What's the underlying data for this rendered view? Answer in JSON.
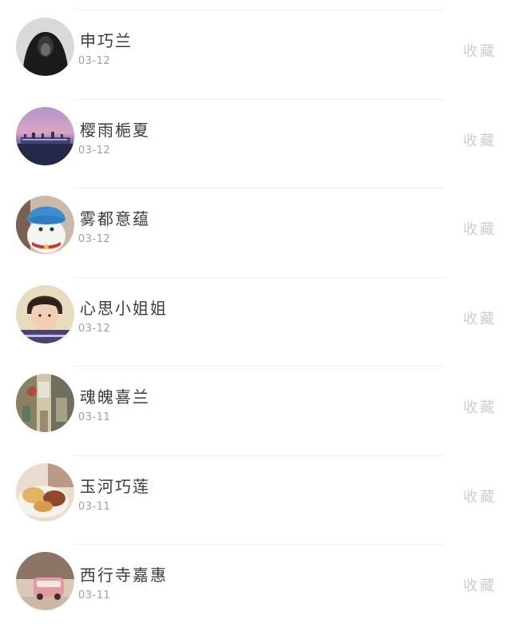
{
  "favorite_label": "收藏",
  "contacts": [
    {
      "name": "申巧兰",
      "date": "03-12",
      "avatar_icon": "hooded-person-avatar"
    },
    {
      "name": "樱雨梔夏",
      "date": "03-12",
      "avatar_icon": "city-skyline-avatar"
    },
    {
      "name": "雾都意蕴",
      "date": "03-12",
      "avatar_icon": "cat-in-hat-avatar"
    },
    {
      "name": "心思小姐姐",
      "date": "03-12",
      "avatar_icon": "boy-portrait-avatar"
    },
    {
      "name": "魂魄喜兰",
      "date": "03-11",
      "avatar_icon": "street-scene-avatar"
    },
    {
      "name": "玉河巧莲",
      "date": "03-11",
      "avatar_icon": "food-plate-avatar"
    },
    {
      "name": "西行寺嘉惠",
      "date": "03-11",
      "avatar_icon": "pink-van-avatar"
    }
  ]
}
